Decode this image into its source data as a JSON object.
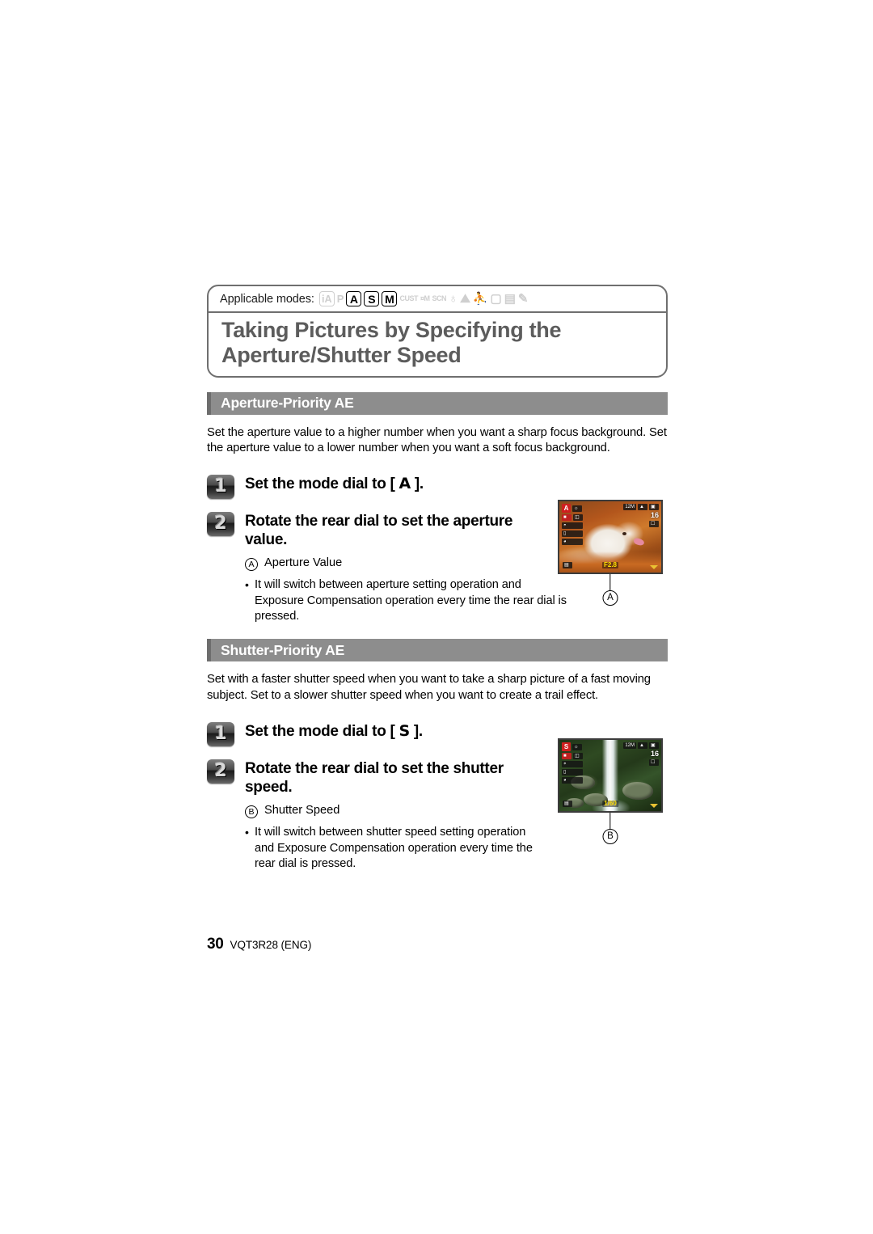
{
  "header": {
    "applicable_modes_label": "Applicable modes:",
    "mode_icons": [
      {
        "name": "intelligent-auto-mode-icon",
        "glyph": "iA",
        "style": "boxed",
        "active": false
      },
      {
        "name": "program-ae-mode-icon",
        "glyph": "P",
        "style": "plain",
        "active": false
      },
      {
        "name": "aperture-priority-mode-icon",
        "glyph": "A",
        "style": "boxed",
        "active": true
      },
      {
        "name": "shutter-priority-mode-icon",
        "glyph": "S",
        "style": "boxed",
        "active": true
      },
      {
        "name": "manual-exposure-mode-icon",
        "glyph": "M",
        "style": "boxed",
        "active": true
      },
      {
        "name": "custom-mode-icon",
        "glyph": "CUST",
        "style": "tiny",
        "active": false
      },
      {
        "name": "creative-motion-picture-mode-icon",
        "glyph": "¤M",
        "style": "tiny",
        "active": false
      },
      {
        "name": "scene-mode-icon",
        "glyph": "SCN",
        "style": "tiny",
        "active": false
      },
      {
        "name": "portrait-scene-icon",
        "glyph": "♁",
        "style": "glyph",
        "active": false
      },
      {
        "name": "scenery-scene-icon",
        "glyph": "⛰",
        "style": "glyph",
        "active": false
      },
      {
        "name": "sports-scene-icon",
        "glyph": "⛹",
        "style": "glyph",
        "active": false
      },
      {
        "name": "night-portrait-scene-icon",
        "glyph": "▢",
        "style": "glyph",
        "active": false
      },
      {
        "name": "panorama-scene-icon",
        "glyph": "▤",
        "style": "glyph",
        "active": false
      },
      {
        "name": "handheld-night-shot-icon",
        "glyph": "✎",
        "style": "glyph",
        "active": false
      }
    ],
    "title": "Taking Pictures by Specifying the Aperture/Shutter Speed"
  },
  "sections": [
    {
      "heading": "Aperture-Priority AE",
      "body": "Set the aperture value to a higher number when you want a sharp focus background. Set the aperture value to a lower number when you want a soft focus background.",
      "steps": [
        {
          "number": "1",
          "text_before": "Set the mode dial to [",
          "dial_key": "A",
          "text_after": "]."
        },
        {
          "number": "2",
          "text_before": "Rotate the rear dial to set the aperture value.",
          "dial_key": "",
          "text_after": ""
        }
      ],
      "callout_marker": "A",
      "callout_label": "Aperture Value",
      "bullet": "It will switch between aperture setting operation and Exposure Compensation operation every time the rear dial is pressed.",
      "screen": {
        "name": "aperture-priority-live-view",
        "mode_badge": "A",
        "resolution_badge": "12M",
        "shots_remaining": "16",
        "value_readout": "F2.8",
        "scene": "white dog on orange background"
      }
    },
    {
      "heading": "Shutter-Priority AE",
      "body": "Set with a faster shutter speed when you want to take a sharp picture of a fast moving subject. Set to a slower shutter speed when you want to create a trail effect.",
      "steps": [
        {
          "number": "1",
          "text_before": "Set the mode dial to [",
          "dial_key": "S",
          "text_after": "]."
        },
        {
          "number": "2",
          "text_before": "Rotate the rear dial to set the shutter speed.",
          "dial_key": "",
          "text_after": ""
        }
      ],
      "callout_marker": "B",
      "callout_label": "Shutter Speed",
      "bullet": "It will switch between shutter speed setting operation and Exposure Compensation operation every time the rear dial is pressed.",
      "screen": {
        "name": "shutter-priority-live-view",
        "mode_badge": "S",
        "resolution_badge": "12M",
        "shots_remaining": "16",
        "value_readout": "1/60",
        "scene": "waterfall over mossy rocks"
      }
    }
  ],
  "footer": {
    "page_number": "30",
    "document_code": "VQT3R28 (ENG)"
  },
  "colors": {
    "section_bar": "#8d8d8d",
    "section_bar_edge": "#6d6d6d",
    "title_text": "#5c5c5c",
    "box_border": "#6f6f6f",
    "mode_badge_red": "#cf1f1f",
    "osd_value_yellow": "#ffe000"
  }
}
